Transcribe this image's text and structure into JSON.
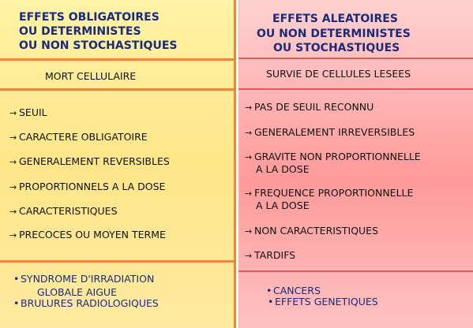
{
  "left": {
    "title_lines": [
      "EFFETS OBLIGATOIRES",
      "OU DETERMINISTES",
      "OU NON STOCHASTIQUES"
    ],
    "subtitle": "MORT CELLULAIRE",
    "items": [
      "SEUIL",
      "CARACTERE OBLIGATOIRE",
      "GENERALEMENT REVERSIBLES",
      "PROPORTIONNELS A LA DOSE",
      "CARACTERISTIQUES",
      "PRECOCES OU MOYEN TERME"
    ],
    "examples": [
      "SYNDROME D'IRRADIATION",
      "GLOBALE AIGUE",
      "BRULURES RADIOLOGIQUES"
    ]
  },
  "right": {
    "title_lines": [
      "EFFETS ALEATOIRES",
      "OU NON DETERMINISTES",
      "OU STOCHASTIQUES"
    ],
    "subtitle": "SURVIE DE CELLULES LESEES",
    "items": [
      {
        "line1": "PAS DE SEUIL RECONNU",
        "line2": ""
      },
      {
        "line1": "GENERALEMENT IRREVERSIBLES",
        "line2": ""
      },
      {
        "line1": "GRAVITE NON PROPORTIONNELLE",
        "line2": "A LA DOSE"
      },
      {
        "line1": "FREQUENCE PROPORTIONNELLE",
        "line2": "A LA DOSE"
      },
      {
        "line1": "NON CARACTERISTIQUES",
        "line2": ""
      },
      {
        "line1": "TARDIFS",
        "line2": ""
      }
    ],
    "examples": [
      "CANCERS",
      "EFFETS GENETIQUES"
    ]
  },
  "icons": {
    "arrow": "→",
    "bullet": "•"
  },
  "colors": {
    "title": "#1a2b7a",
    "left_bg": "#ffe68a",
    "right_bg": "#ff9a9a",
    "divider": "#e8893a"
  }
}
